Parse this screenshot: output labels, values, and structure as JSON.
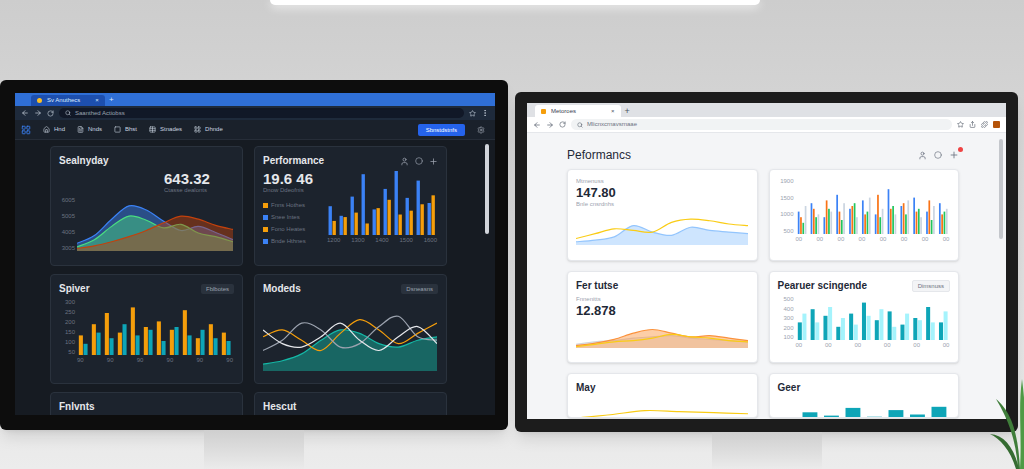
{
  "left_window": {
    "tab": {
      "title": "Sv Anuthecs",
      "close": "×"
    },
    "new_tab": "+",
    "address": "Saanthed Actiobss",
    "nav": [
      "Hnd",
      "Nnds",
      "Bhst",
      "Stnades",
      "Dhnde"
    ],
    "action_button": "Sbnstdstnfs",
    "cards": [
      {
        "kind": "value_chart",
        "title": "Sealnyday",
        "value": "643.32",
        "subtitle": "Ctasse dealonts",
        "ticks_y": [
          "6005",
          "5005",
          "4005",
          "3005"
        ],
        "series": [
          {
            "kind": "area",
            "color": "#3b82f6",
            "values": [
              15,
              30,
              62,
              88,
              80,
              58,
              40,
              48,
              36,
              22
            ]
          },
          {
            "kind": "area",
            "color": "#4ade80",
            "values": [
              8,
              22,
              48,
              68,
              60,
              45,
              52,
              35,
              28,
              18
            ]
          },
          {
            "kind": "area",
            "color": "#c2410c",
            "values": [
              5,
              10,
              18,
              28,
              40,
              55,
              68,
              62,
              50,
              42
            ]
          }
        ]
      },
      {
        "kind": "legend_bars",
        "title": "Performance",
        "value": "19.6 46",
        "subtitle": "Dnow Ddeofnis",
        "legend": [
          {
            "label": "Fnns Hothes",
            "color": "#f59e0b"
          },
          {
            "label": "Snee Intes",
            "color": "#3b82f6"
          },
          {
            "label": "Fono Heates",
            "color": "#f59e0b"
          },
          {
            "label": "Bnde Hthnes",
            "color": "#3b82f6"
          }
        ],
        "ticks_x": [
          "1200",
          "1300",
          "1400",
          "1500",
          "1600"
        ],
        "series": [
          {
            "kind": "bar",
            "color": "#3b82f6",
            "values": [
              45,
              30,
              60,
              95,
              40,
              72,
              100,
              58,
              85,
              50
            ]
          },
          {
            "kind": "bar",
            "color": "#f59e0b",
            "values": [
              22,
              28,
              35,
              18,
              42,
              55,
              32,
              38,
              48,
              62
            ]
          }
        ]
      },
      {
        "kind": "chart",
        "title": "Spiver",
        "button": "Fblbotes",
        "ticks_y": [
          "300",
          "250",
          "200",
          "150",
          "100",
          "50"
        ],
        "ticks_x": [
          "90",
          "90",
          "90",
          "90",
          "90",
          "90"
        ],
        "series": [
          {
            "kind": "bar",
            "color": "#f59e0b",
            "values": [
              35,
              55,
              75,
              40,
              85,
              50,
              60,
              45,
              80,
              30,
              55,
              40
            ]
          },
          {
            "kind": "bar",
            "color": "#0ea5b7",
            "values": [
              20,
              40,
              30,
              55,
              35,
              45,
              25,
              50,
              35,
              45,
              30,
              25
            ]
          }
        ]
      },
      {
        "kind": "chart",
        "title": "Modeds",
        "button": "Dsneasns",
        "series": [
          {
            "kind": "area",
            "color": "#14b8a6",
            "values": [
              10,
              15,
              25,
              45,
              60,
              55,
              40,
              35,
              45,
              50
            ]
          },
          {
            "kind": "line",
            "color": "#f59e0b",
            "values": [
              50,
              60,
              45,
              30,
              55,
              75,
              60,
              40,
              55,
              70
            ]
          },
          {
            "kind": "line",
            "color": "#9ca3af",
            "values": [
              30,
              45,
              70,
              60,
              35,
              40,
              65,
              80,
              50,
              45
            ]
          },
          {
            "kind": "line",
            "color": "#e5e7eb",
            "values": [
              60,
              40,
              35,
              50,
              70,
              45,
              30,
              50,
              65,
              40
            ]
          }
        ]
      },
      {
        "kind": "stub",
        "title": "Fnlvnts",
        "series": []
      },
      {
        "kind": "stub",
        "title": "Hescut",
        "series": []
      }
    ]
  },
  "right_window": {
    "tab": {
      "title": "Metoroes",
      "close": "×"
    },
    "new_tab": "+",
    "address": "Mlicnxcrnavsrnaae",
    "heading": "Peformancs",
    "cards": [
      {
        "kind": "value_chart",
        "label": "Mtmenuss",
        "value": "147.80",
        "subtitle": "Bnle cnsrdnhs",
        "series": [
          {
            "kind": "area",
            "color": "#93c5fd",
            "values": [
              10,
              15,
              25,
              60,
              40,
              30,
              55,
              45,
              40,
              35
            ]
          },
          {
            "kind": "line",
            "color": "#facc15",
            "values": [
              20,
              35,
              50,
              45,
              40,
              70,
              80,
              75,
              65,
              60
            ]
          }
        ]
      },
      {
        "kind": "chart",
        "ticks_y": [
          "1900",
          "1500",
          "1000",
          "500"
        ],
        "ticks_x": [
          "00",
          "00",
          "00",
          "00",
          "00",
          "00",
          "00",
          "00"
        ],
        "series": [
          {
            "kind": "bar",
            "color": "#3b82f6",
            "values": [
              40,
              55,
              30,
              70,
              45,
              60,
              35,
              80,
              50,
              65,
              40,
              55
            ]
          },
          {
            "kind": "bar",
            "color": "#f97316",
            "values": [
              30,
              45,
              60,
              40,
              50,
              35,
              70,
              45,
              55,
              40,
              60,
              35
            ]
          },
          {
            "kind": "bar",
            "color": "#22c55e",
            "values": [
              20,
              30,
              45,
              25,
              55,
              40,
              30,
              50,
              35,
              45,
              25,
              40
            ]
          },
          {
            "kind": "bar",
            "color": "#cbd5e1",
            "values": [
              50,
              35,
              40,
              55,
              30,
              65,
              45,
              35,
              60,
              30,
              50,
              45
            ]
          }
        ]
      },
      {
        "kind": "value_chart",
        "title": "Fer tutse",
        "label": "Fnnenitts",
        "value": "12.878",
        "series": [
          {
            "kind": "area",
            "color": "#d1d5db",
            "values": [
              15,
              25,
              30,
              40,
              45,
              50,
              40,
              35,
              30,
              25
            ]
          },
          {
            "kind": "area",
            "color": "#fb923c",
            "values": [
              10,
              20,
              35,
              60,
              75,
              60,
              45,
              50,
              40,
              30
            ]
          },
          {
            "kind": "line",
            "color": "#facc15",
            "values": [
              5,
              15,
              25,
              30,
              40,
              55,
              45,
              40,
              30,
              25
            ]
          }
        ]
      },
      {
        "kind": "chart",
        "title": "Pearuer scingende",
        "button": "Dimsnuss",
        "ticks_y": [
          "500",
          "400",
          "300",
          "200",
          "100"
        ],
        "ticks_x": [
          "00",
          "00",
          "00",
          "00",
          "00",
          "00"
        ],
        "series": [
          {
            "kind": "bar",
            "color": "#0ea5b7",
            "values": [
              40,
              70,
              55,
              30,
              60,
              85,
              45,
              65,
              35,
              50,
              75,
              40
            ]
          },
          {
            "kind": "bar",
            "color": "#a5f3fc",
            "values": [
              60,
              40,
              75,
              50,
              35,
              55,
              70,
              30,
              60,
              45,
              40,
              65
            ]
          }
        ]
      },
      {
        "kind": "stub",
        "title": "May",
        "series": [
          {
            "kind": "line",
            "color": "#facc15",
            "values": [
              10,
              25,
              45,
              40,
              35,
              30
            ]
          }
        ]
      },
      {
        "kind": "stub",
        "title": "Geer",
        "series": [
          {
            "kind": "bar",
            "color": "#0ea5b7",
            "values": [
              10,
              35,
              20,
              55,
              15,
              45,
              25,
              60
            ]
          }
        ]
      }
    ]
  }
}
